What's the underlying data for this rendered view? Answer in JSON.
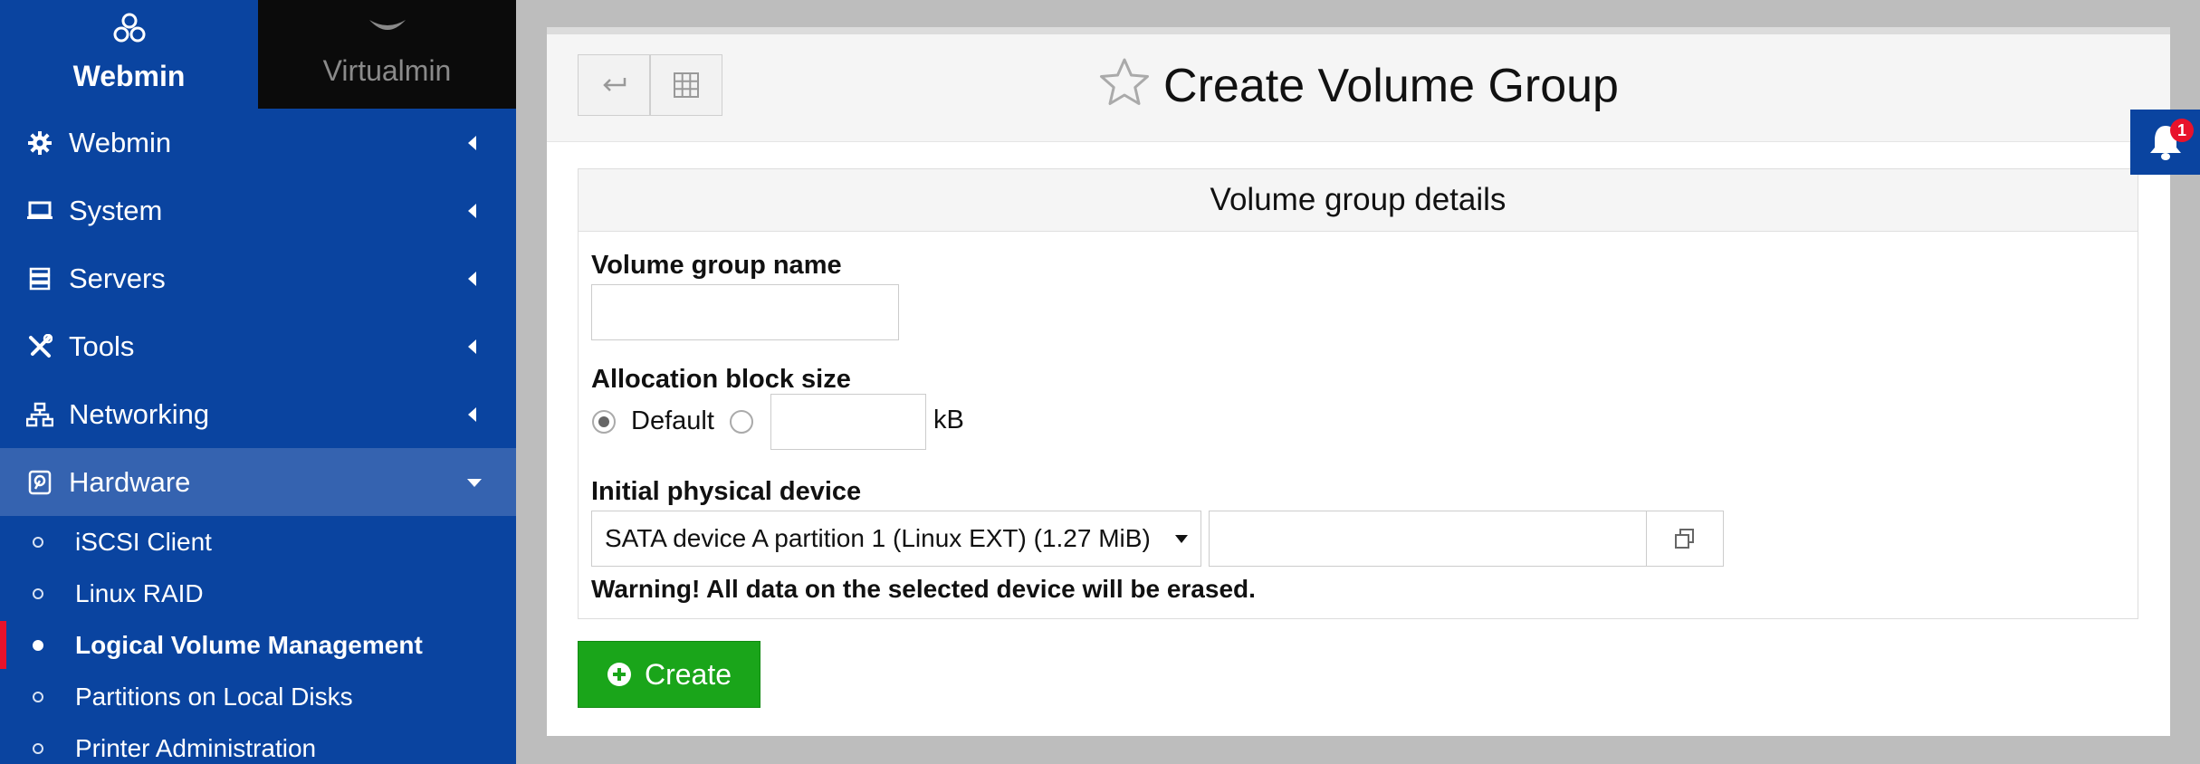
{
  "sidebar": {
    "tabs": [
      {
        "label": "Webmin",
        "icon": "webmin-logo-icon"
      },
      {
        "label": "Virtualmin",
        "icon": "chevron-down-icon"
      }
    ],
    "menu": [
      {
        "label": "Webmin",
        "icon": "gear-icon",
        "expanded": false
      },
      {
        "label": "System",
        "icon": "laptop-icon",
        "expanded": false
      },
      {
        "label": "Servers",
        "icon": "server-icon",
        "expanded": false
      },
      {
        "label": "Tools",
        "icon": "tools-icon",
        "expanded": false
      },
      {
        "label": "Networking",
        "icon": "network-icon",
        "expanded": false
      },
      {
        "label": "Hardware",
        "icon": "harddisk-icon",
        "expanded": true
      }
    ],
    "hardware_items": [
      {
        "label": "iSCSI Client"
      },
      {
        "label": "Linux RAID"
      },
      {
        "label": "Logical Volume Management",
        "current": true
      },
      {
        "label": "Partitions on Local Disks"
      },
      {
        "label": "Printer Administration"
      }
    ]
  },
  "header": {
    "title": "Create Volume Group"
  },
  "section": {
    "title": "Volume group details",
    "vg_name": {
      "label": "Volume group name",
      "value": ""
    },
    "block_size": {
      "label": "Allocation block size",
      "default_label": "Default",
      "selected": "default",
      "custom_value": "",
      "unit": "kB"
    },
    "device": {
      "label": "Initial physical device",
      "selected": "SATA device A partition 1 (Linux EXT) (1.27 MiB)",
      "custom_path": "",
      "warning": "Warning! All data on the selected device will be erased."
    }
  },
  "actions": {
    "create_label": "Create"
  },
  "notifications": {
    "count": "1"
  },
  "colors": {
    "sidebar": "#0a44a0",
    "sidebar_active": "#3563b0",
    "create_button": "#1aa51a",
    "badge": "#e8122b"
  }
}
